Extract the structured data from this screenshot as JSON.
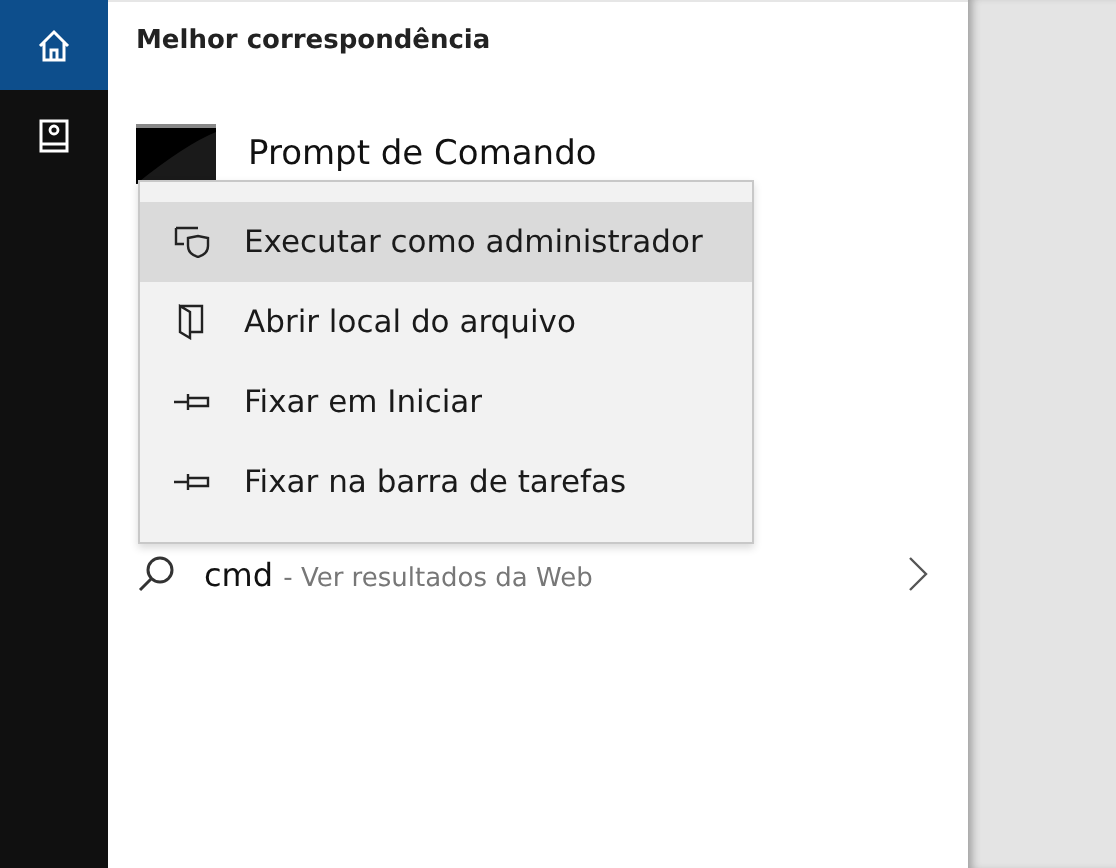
{
  "sidebar": {
    "items": [
      {
        "kind": "home",
        "selected": true
      },
      {
        "kind": "notebook",
        "selected": false
      }
    ]
  },
  "section_title": "Melhor correspondência",
  "best_match": {
    "title": "Prompt de Comando"
  },
  "web_result": {
    "query": "cmd",
    "suffix": "- Ver resultados da Web"
  },
  "context_menu": {
    "items": [
      {
        "kind": "shield",
        "label": "Executar como administrador",
        "selected": true
      },
      {
        "kind": "folder",
        "label": "Abrir local do arquivo",
        "selected": false
      },
      {
        "kind": "pin",
        "label": "Fixar em Iniciar",
        "selected": false
      },
      {
        "kind": "pin",
        "label": "Fixar na barra de tarefas",
        "selected": false
      }
    ]
  }
}
